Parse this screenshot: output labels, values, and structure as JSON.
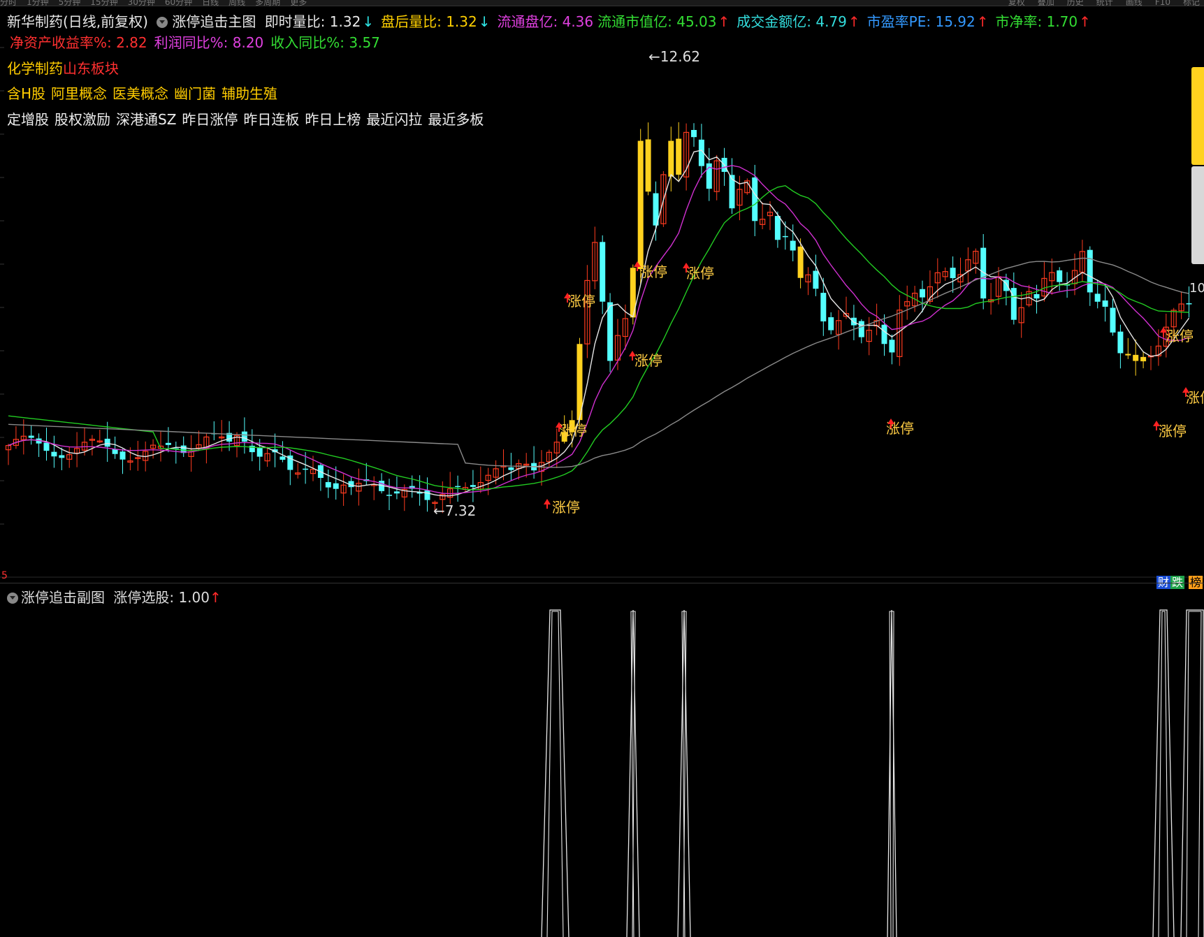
{
  "toolbar": {
    "left_items": [
      "分时",
      "1分钟",
      "5分钟",
      "15分钟",
      "30分钟",
      "60分钟",
      "日线",
      "周线",
      "多周期",
      "更多"
    ],
    "right_items": [
      "复权",
      "叠加",
      "历史",
      "统计",
      "画线",
      "F10",
      "标记"
    ]
  },
  "info": {
    "stock_name": "新华制药(日线,前复权)",
    "indicator_main": "涨停追击主图",
    "line1": [
      {
        "label": "即时量比: 1.32",
        "arrow": "↓",
        "color": "#e8e8e8",
        "dir": "dn"
      },
      {
        "label": "盘后量比: 1.32",
        "arrow": "↓",
        "color": "#ffd000",
        "dir": "dn"
      },
      {
        "label": "流通盘亿: 4.36",
        "arrow": "",
        "color": "#e040e0",
        "dir": ""
      },
      {
        "label": "流通市值亿: 45.03",
        "arrow": "↑",
        "color": "#33dd33",
        "dir": "up"
      },
      {
        "label": "成交金额亿: 4.79",
        "arrow": "↑",
        "color": "#33dddd",
        "dir": "up"
      },
      {
        "label": "市盈率PE: 15.92",
        "arrow": "↑",
        "color": "#3399ff",
        "dir": "up"
      },
      {
        "label": "市净率: 1.70",
        "arrow": "↑",
        "color": "#33dd33",
        "dir": "up"
      }
    ],
    "line2": [
      {
        "label": "净资产收益率%: 2.82",
        "color": "#ff3030"
      },
      {
        "label": "利润同比%: 8.20",
        "color": "#e040e0"
      },
      {
        "label": "收入同比%: 3.57",
        "color": "#33dd33"
      }
    ]
  },
  "tags": {
    "industry": "化学制药",
    "region": "山东板块",
    "concepts": [
      "含H股",
      "阿里概念",
      "医美概念",
      "幽门菌",
      "辅助生殖"
    ],
    "status": [
      "定增股",
      "股权激励",
      "深港通SZ",
      "昨日涨停",
      "昨日连板",
      "昨日上榜",
      "最近闪拉",
      "最近多板"
    ]
  },
  "chart": {
    "high_label": "12.62",
    "low_label": "7.32",
    "zt_label": "涨停",
    "right_edge_label": "10",
    "bottom_badge_cai": "财",
    "bottom_badge_die": "跌",
    "bottom_badge_bang": "榜",
    "corner_mark": "5",
    "colors": {
      "up": "#ff3b1f",
      "down": "#54ffff",
      "limit_up": "#ffd21f",
      "ma5": "#e6e6e6",
      "ma10": "#d030d0",
      "ma20": "#22cc22",
      "ma60": "#8a8a8a",
      "zt_text": "#ffcc44",
      "arrow": "#ff2222"
    }
  },
  "sub": {
    "indicator_name": "涨停追击副图",
    "value_label": "涨停选股: 1.00",
    "value_arrow": "↑"
  }
}
